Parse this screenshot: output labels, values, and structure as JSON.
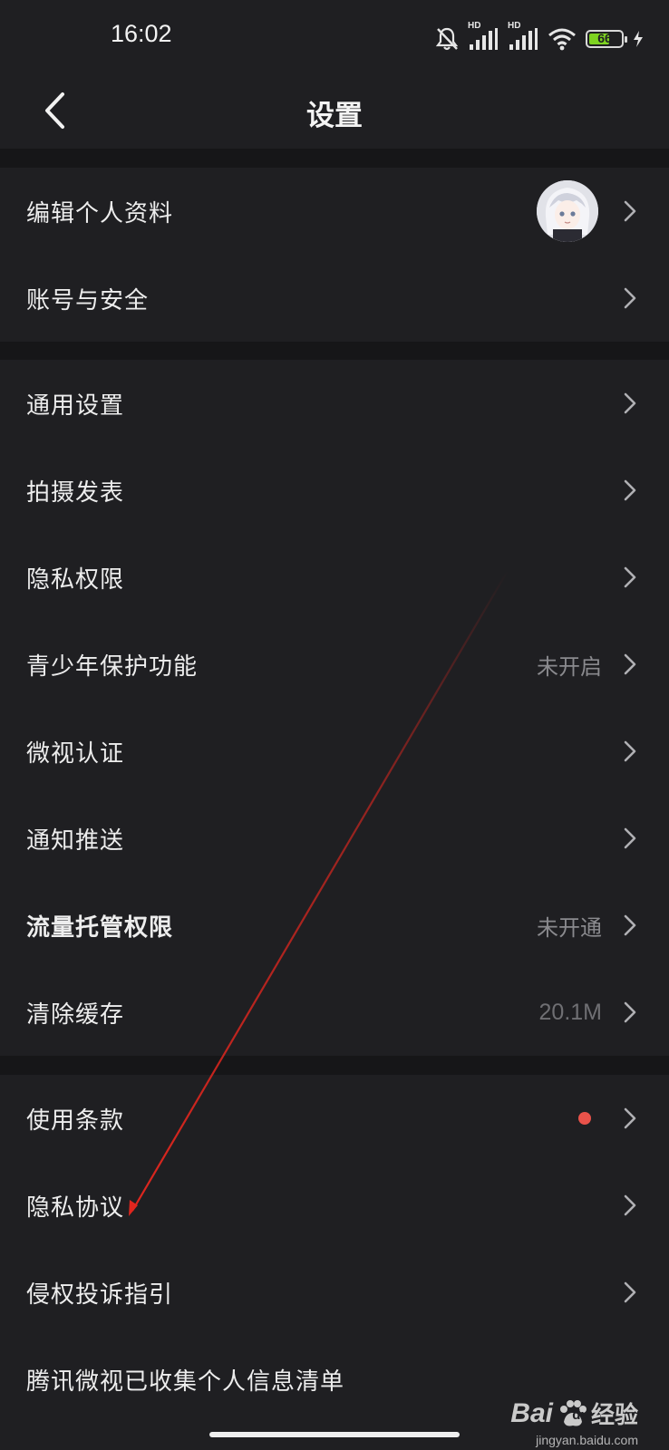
{
  "status_bar": {
    "time": "16:02",
    "battery_level": "66",
    "battery_fraction": 0.66,
    "signal_label_1": "HD",
    "signal_label_2": "HD",
    "icons": [
      "mute-bell-icon",
      "signal-hd-icon",
      "signal-hd-icon",
      "wifi-icon",
      "battery-icon",
      "charging-icon"
    ]
  },
  "header": {
    "title": "设置",
    "back_icon": "chevron-left-icon"
  },
  "sections": {
    "account": [
      {
        "label": "编辑个人资料",
        "has_avatar": true
      },
      {
        "label": "账号与安全"
      }
    ],
    "general": [
      {
        "label": "通用设置"
      },
      {
        "label": "拍摄发表"
      },
      {
        "label": "隐私权限"
      },
      {
        "label": "青少年保护功能",
        "value": "未开启"
      },
      {
        "label": "微视认证"
      },
      {
        "label": "通知推送"
      },
      {
        "label": "流量托管权限",
        "value": "未开通"
      },
      {
        "label": "清除缓存",
        "value": "20.1M"
      }
    ],
    "legal": [
      {
        "label": "使用条款",
        "has_badge": true
      },
      {
        "label": "隐私协议"
      },
      {
        "label": "侵权投诉指引"
      },
      {
        "label": "腾讯微视已收集个人信息清单"
      }
    ]
  },
  "colors": {
    "background": "#161618",
    "surface": "#1f1f22",
    "text": "#ededed",
    "secondary_text": "#8a8a8e",
    "badge": "#e9524a",
    "annotation_arrow": "#e0261e",
    "battery_fill": "#7ed321"
  },
  "watermark": {
    "brand": "Bai",
    "brand2": "du",
    "suffix": "经验",
    "url": "jingyan.baidu.com"
  }
}
